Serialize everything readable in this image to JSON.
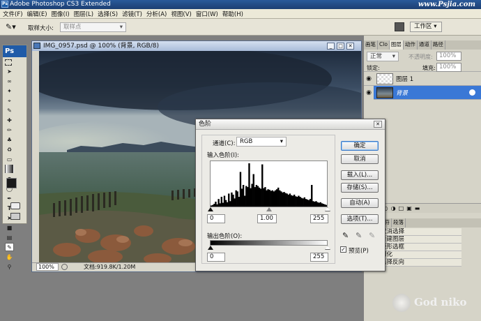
{
  "app": {
    "title": "Adobe Photoshop CS3 Extended",
    "logo": "Ps",
    "watermark": "www.Psjia.com"
  },
  "menu": [
    "文件(F)",
    "编辑(E)",
    "图像(I)",
    "图层(L)",
    "选择(S)",
    "滤镜(T)",
    "分析(A)",
    "视图(V)",
    "窗口(W)",
    "帮助(H)"
  ],
  "options": {
    "tool_icon": "eyedropper-icon",
    "sample_label": "取样大小:",
    "sample_value": "取样点",
    "workspace_label": "工作区"
  },
  "document": {
    "title": "IMG_0957.psd @ 100% (背景, RGB/8)",
    "zoom": "100%",
    "doc_info": "文档:919.8K/1.20M"
  },
  "layers_panel": {
    "tabs": [
      "画笔",
      "Clo",
      "图层",
      "动作",
      "通道",
      "路径"
    ],
    "blend": "正常",
    "opacity_label": "不透明度:",
    "opacity": "100%",
    "lock_label": "锁定:",
    "fill_label": "填充:",
    "fill": "100%",
    "layers": [
      {
        "name": "图层 1",
        "selected": false
      },
      {
        "name": "背景",
        "selected": true
      }
    ]
  },
  "history_panel": {
    "tabs": [
      "历史",
      "字符",
      "段落"
    ],
    "items": [
      "取消选择",
      "新建图层",
      "矩形选框",
      "羽化",
      "选择反向"
    ]
  },
  "levels_dialog": {
    "title": "色阶",
    "channel_label": "通道(C):",
    "channel": "RGB",
    "input_label": "输入色阶(I):",
    "input_black": "0",
    "input_gamma": "1.00",
    "input_white": "255",
    "output_label": "输出色阶(O):",
    "output_black": "0",
    "output_white": "255",
    "buttons": {
      "ok": "确定",
      "cancel": "取消",
      "load": "载入(L)...",
      "save": "存储(S)...",
      "auto": "自动(A)",
      "options": "选项(T)..."
    },
    "preview_label": "预览(P)",
    "preview_checked": true,
    "histogram": [
      2,
      3,
      5,
      9,
      4,
      14,
      6,
      18,
      7,
      20,
      12,
      8,
      24,
      10,
      26,
      22,
      15,
      30,
      28,
      18,
      64,
      33,
      40,
      20,
      38,
      36,
      80,
      34,
      42,
      60,
      36,
      40,
      38,
      35,
      33,
      78,
      34,
      36,
      30,
      32,
      31,
      29,
      30,
      28,
      30,
      32,
      35,
      30,
      28,
      26,
      27,
      25,
      24,
      22,
      24,
      21,
      20,
      22,
      19,
      18,
      20,
      18,
      16,
      15,
      17,
      14,
      13,
      12,
      14,
      40,
      10,
      9,
      10,
      8,
      7,
      8,
      6,
      5,
      4,
      3
    ]
  },
  "corner_logo": "God niko",
  "colors": {
    "accent": "#3b79c8",
    "titlebar": "#1c3f72",
    "selected_layer": "#3a78d6"
  }
}
